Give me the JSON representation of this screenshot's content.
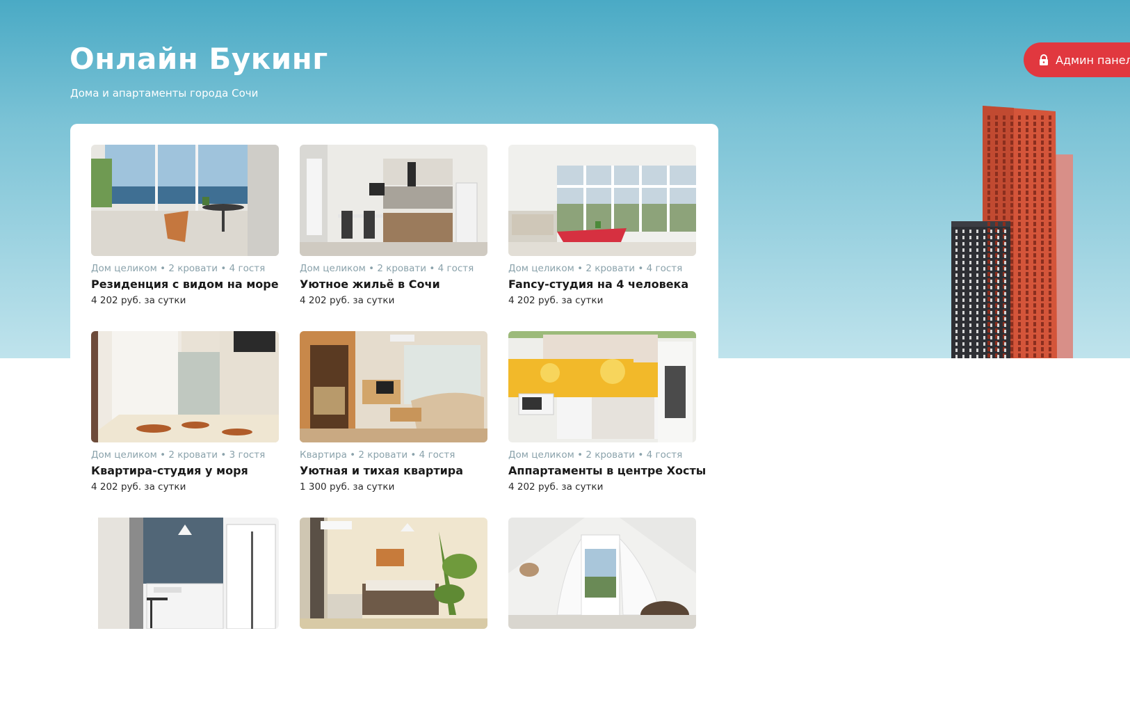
{
  "header": {
    "title": "Онлайн Букинг",
    "subtitle": "Дома и апартаменты города Сочи",
    "admin_button": {
      "label": "Админ панель",
      "icon": "lock-icon"
    }
  },
  "colors": {
    "accent_red": "#e1383f",
    "hero_top": "#4aaac5",
    "hero_bottom": "#bfe3ec",
    "meta_text": "#8aa2ab"
  },
  "listings": [
    {
      "meta": "Дом целиком • 2 кровати • 4 гостя",
      "title": "Резиденция с видом на море",
      "price": "4 202 руб. за сутки",
      "photo": "sea-view-balcony"
    },
    {
      "meta": "Дом целиком • 2 кровати • 4 гостя",
      "title": "Уютное жильё в Сочи",
      "price": "4 202 руб. за сутки",
      "photo": "kitchen-dining"
    },
    {
      "meta": "Дом целиком • 2 кровати • 4 гостя",
      "title": "Fancy-студия на 4 человека",
      "price": "4 202 руб. за сутки",
      "photo": "glass-veranda"
    },
    {
      "meta": "Дом целиком • 2 кровати • 3 гостя",
      "title": "Квартира-студия у моря",
      "price": "4 202 руб. за сутки",
      "photo": "bedroom-curtains"
    },
    {
      "meta": "Квартира • 2 кровати • 4 гостя",
      "title": "Уютная и тихая квартира",
      "price": "1 300 руб. за сутки",
      "photo": "living-room-sofa"
    },
    {
      "meta": "Дом целиком • 2 кровати • 4 гостя",
      "title": "Аппартаменты в центре Хосты",
      "price": "4 202 руб. за сутки",
      "photo": "yellow-kitchen"
    },
    {
      "meta": "",
      "title": "",
      "price": "",
      "photo": "white-kitchenette"
    },
    {
      "meta": "",
      "title": "",
      "price": "",
      "photo": "bedroom-plant"
    },
    {
      "meta": "",
      "title": "",
      "price": "",
      "photo": "attic-balcony"
    }
  ]
}
